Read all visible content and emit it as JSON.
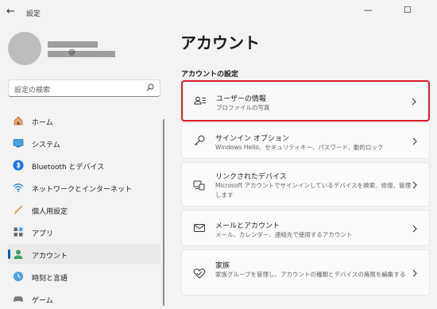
{
  "window": {
    "title": "設定",
    "back_icon": "back-arrow-icon",
    "controls": [
      "minimize-icon",
      "maximize-icon"
    ]
  },
  "profile": {
    "email_visible": "@"
  },
  "search": {
    "placeholder": "設定の検索"
  },
  "sidebar": {
    "items": [
      {
        "label": "ホーム",
        "icon": "home-icon"
      },
      {
        "label": "システム",
        "icon": "system-icon"
      },
      {
        "label": "Bluetooth とデバイス",
        "icon": "bluetooth-icon"
      },
      {
        "label": "ネットワークとインターネット",
        "icon": "network-icon"
      },
      {
        "label": "個人用設定",
        "icon": "personalization-icon"
      },
      {
        "label": "アプリ",
        "icon": "apps-icon"
      },
      {
        "label": "アカウント",
        "icon": "account-icon",
        "active": true
      },
      {
        "label": "時刻と言語",
        "icon": "time-language-icon"
      },
      {
        "label": "ゲーム",
        "icon": "gaming-icon"
      }
    ]
  },
  "main": {
    "title": "アカウント",
    "section_title": "アカウントの設定",
    "cards": [
      {
        "title": "ユーザーの情報",
        "desc": "プロファイルの写真",
        "icon": "user-info-icon",
        "highlight": true
      },
      {
        "title": "サインイン オプション",
        "desc": "Windows Hello、セキュリティキー、パスワード、動的ロック",
        "icon": "key-icon"
      },
      {
        "title": "リンクされたデバイス",
        "desc": "Microsoft アカウントでサインインしているデバイスを検索、修復、管理します",
        "icon": "linked-devices-icon"
      },
      {
        "title": "メールとアカウント",
        "desc": "メール、カレンダー、連絡先で使用するアカウント",
        "icon": "mail-icon"
      },
      {
        "title": "家族",
        "desc": "家族グループを管理し、アカウントの種類とデバイスの権限を編集する",
        "icon": "family-heart-icon"
      }
    ]
  },
  "colors": {
    "accent": "#005fb8",
    "highlight_border": "#d81f2a",
    "background": "#f3f3f3",
    "card": "#fbfbfb"
  }
}
